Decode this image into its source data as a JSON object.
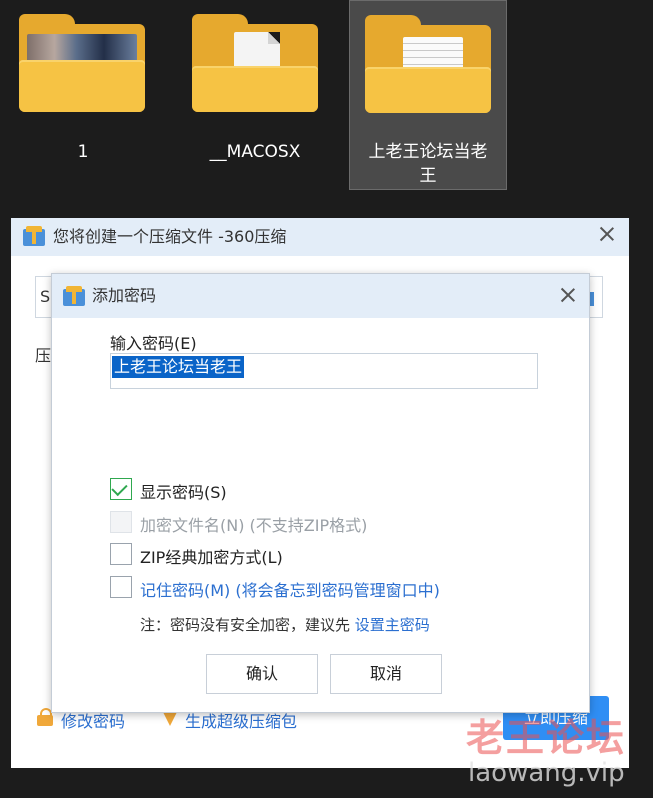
{
  "explorer": {
    "folders": [
      {
        "name": "1",
        "thumbnail": "photo"
      },
      {
        "name": "__MACOSX",
        "thumbnail": "blank-document"
      },
      {
        "name": "上老王论坛当老王",
        "thumbnail": "text-document",
        "selected": true
      }
    ]
  },
  "main_window": {
    "title": "您将创建一个压缩文件 -360压缩",
    "path_fragment": "S",
    "label_fragment": "压",
    "bottom_links": {
      "modify_password": "修改密码",
      "generate_super": "生成超级压缩包"
    },
    "start_button": "立即压缩"
  },
  "dialog": {
    "title": "添加密码",
    "password_label": "输入密码(E)",
    "password_value": "上老王论坛当老王",
    "options": {
      "show_password": "显示密码(S)",
      "encrypt_filename": "加密文件名(N) (不支持ZIP格式)",
      "zip_classic": "ZIP经典加密方式(L)",
      "remember_password": "记住密码(M) (将会备忘到密码管理窗口中)"
    },
    "note_prefix": "注：密码没有安全加密，建议先 ",
    "note_link": "设置主密码",
    "ok_button": "确认",
    "cancel_button": "取消"
  },
  "watermark": {
    "text": "老王论坛",
    "url": "laowang.vip"
  },
  "colors": {
    "accent_blue": "#2b6fd0",
    "check_green": "#2fa84f",
    "folder_yellow": "#f6c344"
  }
}
